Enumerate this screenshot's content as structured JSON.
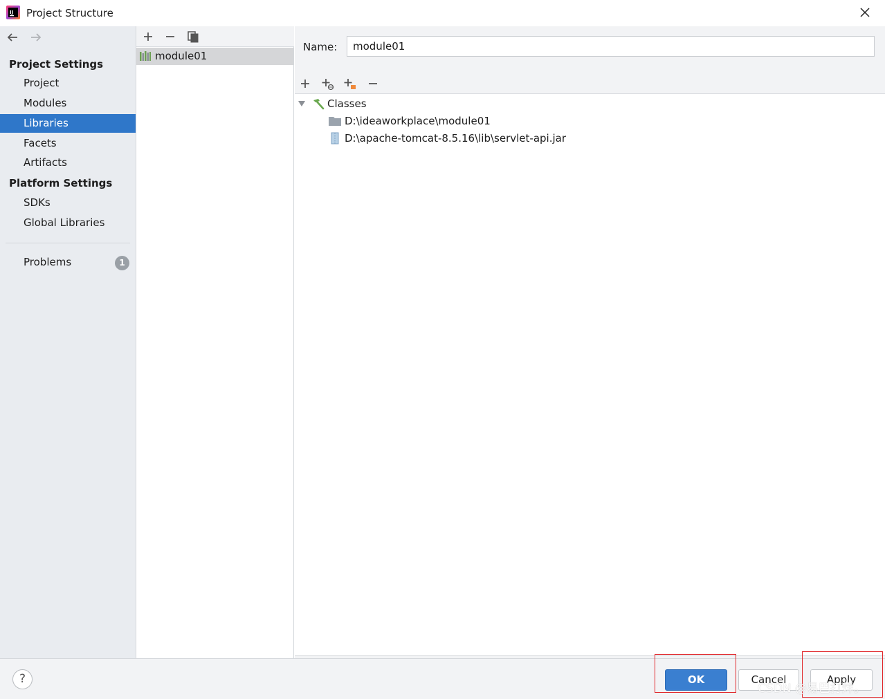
{
  "window": {
    "title": "Project Structure",
    "close_icon": "close-icon"
  },
  "sidebar": {
    "back_icon": "arrow-left-icon",
    "forward_icon": "arrow-right-icon",
    "project_settings_heading": "Project Settings",
    "project_settings_items": [
      {
        "label": "Project",
        "selected": false
      },
      {
        "label": "Modules",
        "selected": false
      },
      {
        "label": "Libraries",
        "selected": true
      },
      {
        "label": "Facets",
        "selected": false
      },
      {
        "label": "Artifacts",
        "selected": false
      }
    ],
    "platform_settings_heading": "Platform Settings",
    "platform_settings_items": [
      {
        "label": "SDKs"
      },
      {
        "label": "Global Libraries"
      }
    ],
    "problems_label": "Problems",
    "problems_count": "1",
    "selected_color": "#2f77c9"
  },
  "library_list": {
    "toolbar_icons": [
      "plus-icon",
      "minus-icon",
      "copy-icon"
    ],
    "items": [
      {
        "label": "module01",
        "icon": "library-icon",
        "selected": true
      }
    ]
  },
  "detail": {
    "name_label": "Name:",
    "name_value": "module01",
    "toolbar_icons": [
      "plus-icon",
      "add-url-icon",
      "add-jar-icon",
      "minus-icon"
    ],
    "tree": {
      "root_label": "Classes",
      "root_icon": "hammer-icon",
      "children": [
        {
          "label": "D:\\ideaworkplace\\module01",
          "icon": "folder-icon"
        },
        {
          "label": "D:\\apache-tomcat-8.5.16\\lib\\servlet-api.jar",
          "icon": "jar-icon"
        }
      ]
    }
  },
  "footer": {
    "help_label": "?",
    "ok_label": "OK",
    "cancel_label": "Cancel",
    "apply_label": "Apply",
    "watermark": "CSDN @易巴打烊。",
    "ok_color": "#3a7fd0",
    "highlight_color": "#e0262a"
  }
}
